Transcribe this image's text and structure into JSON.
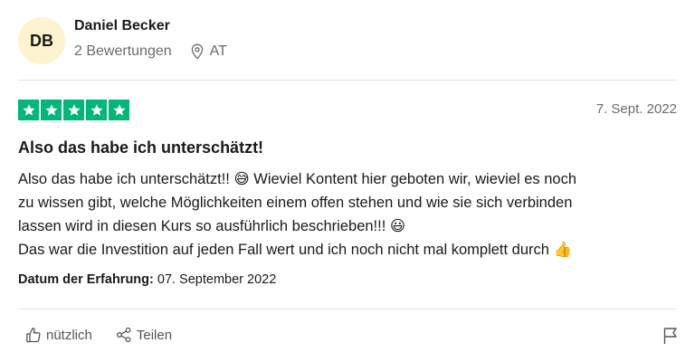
{
  "reviewer": {
    "initials": "DB",
    "name": "Daniel Becker",
    "reviews_count": "2 Bewertungen",
    "country": "AT",
    "avatar_color": "#fdf4cf"
  },
  "review": {
    "rating": 5,
    "max_rating": 5,
    "star_color": "#00b67a",
    "date": "7. Sept. 2022",
    "title": "Also das habe ich unterschätzt!",
    "body_lines": [
      "Also das habe ich unterschätzt!! 😅 Wieviel Kontent hier geboten wir, wieviel es noch",
      "zu wissen gibt, welche Möglichkeiten einem offen stehen und wie sie sich verbinden",
      "lassen wird in diesen Kurs so ausführlich beschrieben!!! 😃",
      "Das war die Investition auf jeden Fall wert und ich noch nicht mal komplett durch 👍"
    ],
    "experience_label": "Datum der Erfahrung:",
    "experience_date": "07. September 2022"
  },
  "actions": {
    "useful_label": "nützlich",
    "share_label": "Teilen",
    "useful_icon": "thumbs-up-icon",
    "share_icon": "share-icon",
    "flag_icon": "flag-icon"
  }
}
